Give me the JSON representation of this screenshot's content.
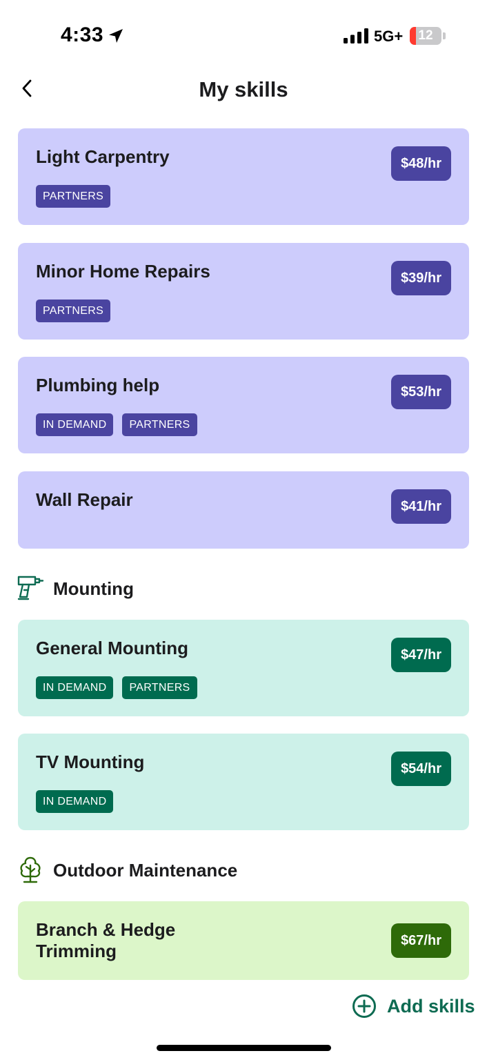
{
  "status_bar": {
    "time": "4:33",
    "location_icon": "location-arrow-icon",
    "signal_icon": "cellular-signal-icon",
    "network": "5G+",
    "battery_level": "12",
    "battery_fraction": 0.12,
    "battery_color": "#ff3b30"
  },
  "nav": {
    "back_icon": "chevron-left-icon",
    "title": "My skills"
  },
  "colors": {
    "purple_card": "#cdccfc",
    "purple_badge": "#4a44a0",
    "teal_card": "#cdf1e9",
    "teal_badge": "#006b4f",
    "lime_card": "#dcf6c9",
    "lime_badge": "#2e6a09",
    "accent_green": "#0e6b52"
  },
  "sections": [
    {
      "title": "",
      "icon": "",
      "skills": [
        {
          "name": "Light Carpentry",
          "rate": "$48/hr",
          "tags": [
            "PARTNERS"
          ]
        },
        {
          "name": "Minor Home Repairs",
          "rate": "$39/hr",
          "tags": [
            "PARTNERS"
          ]
        },
        {
          "name": "Plumbing help",
          "rate": "$53/hr",
          "tags": [
            "IN DEMAND",
            "PARTNERS"
          ]
        },
        {
          "name": "Wall Repair",
          "rate": "$41/hr",
          "tags": []
        }
      ]
    },
    {
      "title": "Mounting",
      "icon": "drill-icon",
      "skills": [
        {
          "name": "General Mounting",
          "rate": "$47/hr",
          "tags": [
            "IN DEMAND",
            "PARTNERS"
          ]
        },
        {
          "name": "TV Mounting",
          "rate": "$54/hr",
          "tags": [
            "IN DEMAND"
          ]
        }
      ]
    },
    {
      "title": "Outdoor Maintenance",
      "icon": "tree-icon",
      "skills": [
        {
          "name": "Branch & Hedge Trimming",
          "rate": "$67/hr",
          "tags": []
        }
      ]
    }
  ],
  "add_skills": {
    "label": "Add skills",
    "icon": "plus-circle-icon"
  }
}
